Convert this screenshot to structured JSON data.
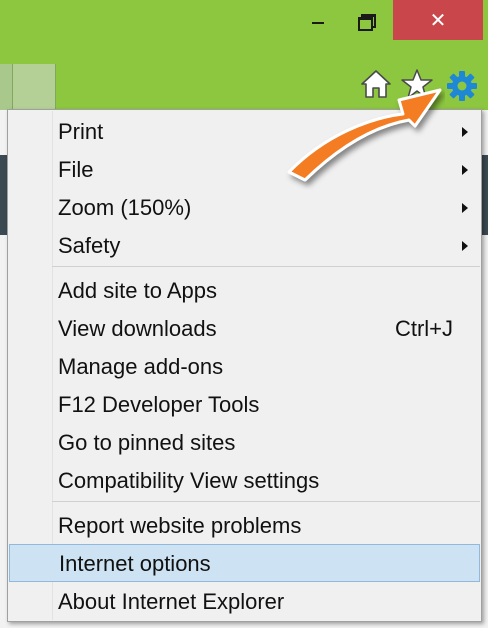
{
  "window": {
    "minimize_label": "–",
    "close_label": "✕"
  },
  "toolbar": {
    "icons": [
      "home-icon",
      "favorites-star-icon",
      "tools-gear-icon"
    ]
  },
  "colors": {
    "titlebar": "#8dc63f",
    "close_button": "#c9474a",
    "gear": "#1e88d6",
    "callout_arrow": "#f47b20",
    "selected_item": "#cde3f3"
  },
  "menu": {
    "items": [
      {
        "label": "Print",
        "submenu": true
      },
      {
        "label": "File",
        "submenu": true
      },
      {
        "label": "Zoom (150%)",
        "submenu": true
      },
      {
        "label": "Safety",
        "submenu": true
      },
      {
        "label": "Add site to Apps"
      },
      {
        "label": "View downloads",
        "shortcut": "Ctrl+J"
      },
      {
        "label": "Manage add-ons"
      },
      {
        "label": "F12 Developer Tools"
      },
      {
        "label": "Go to pinned sites"
      },
      {
        "label": "Compatibility View settings"
      },
      {
        "label": "Report website problems"
      },
      {
        "label": "Internet options",
        "selected": true
      },
      {
        "label": "About Internet Explorer"
      }
    ]
  }
}
